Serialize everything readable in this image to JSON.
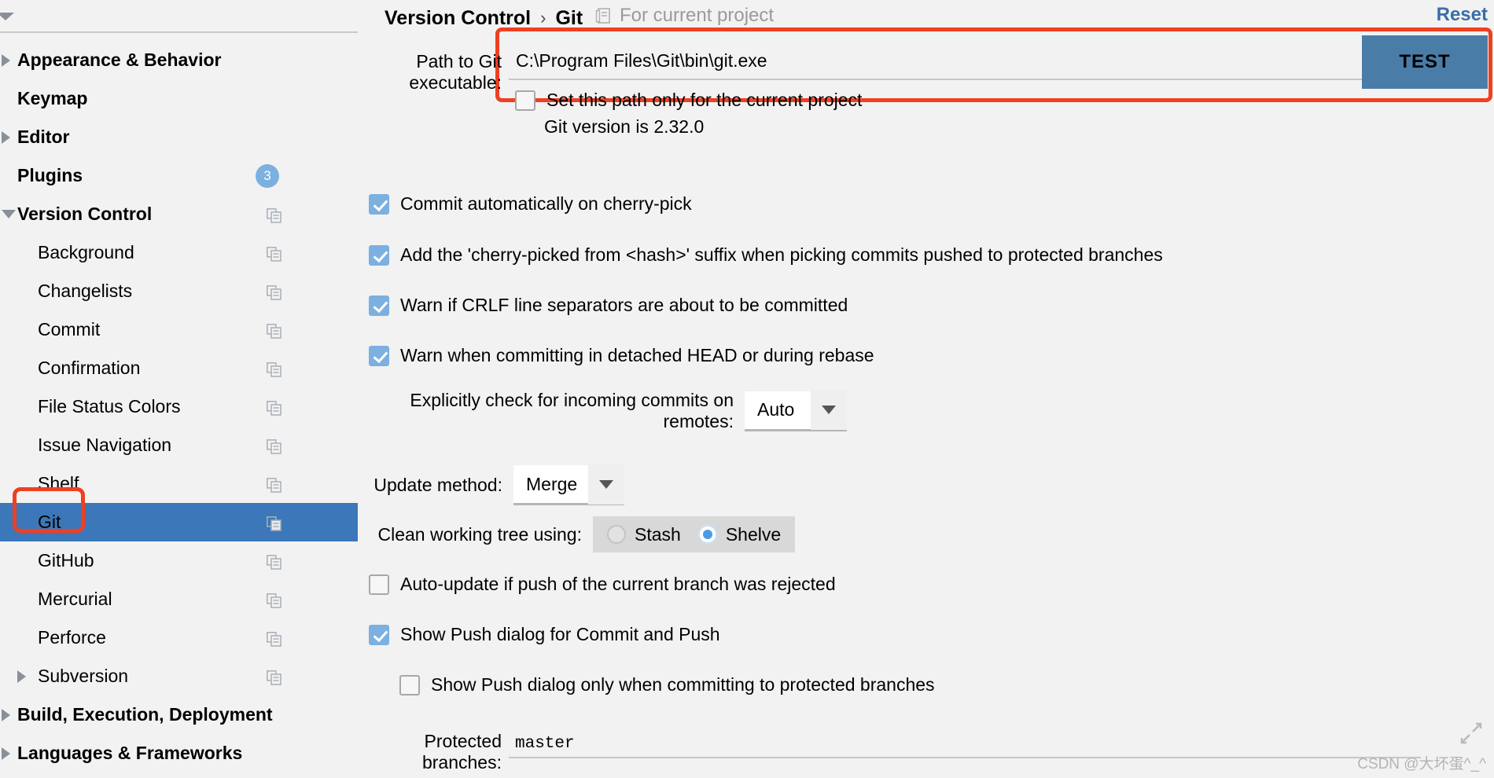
{
  "sidebar": {
    "items": [
      {
        "label": "Appearance & Behavior",
        "depth": 0,
        "twisty": "collapsed",
        "badge": null,
        "copy": false,
        "selected": false
      },
      {
        "label": "Keymap",
        "depth": 0,
        "twisty": "none",
        "badge": null,
        "copy": false,
        "selected": false
      },
      {
        "label": "Editor",
        "depth": 0,
        "twisty": "collapsed",
        "badge": null,
        "copy": false,
        "selected": false
      },
      {
        "label": "Plugins",
        "depth": 0,
        "twisty": "none",
        "badge": "3",
        "copy": false,
        "selected": false
      },
      {
        "label": "Version Control",
        "depth": 0,
        "twisty": "expanded",
        "badge": null,
        "copy": true,
        "selected": false
      },
      {
        "label": "Background",
        "depth": 1,
        "twisty": "none",
        "badge": null,
        "copy": true,
        "selected": false
      },
      {
        "label": "Changelists",
        "depth": 1,
        "twisty": "none",
        "badge": null,
        "copy": true,
        "selected": false
      },
      {
        "label": "Commit",
        "depth": 1,
        "twisty": "none",
        "badge": null,
        "copy": true,
        "selected": false
      },
      {
        "label": "Confirmation",
        "depth": 1,
        "twisty": "none",
        "badge": null,
        "copy": true,
        "selected": false
      },
      {
        "label": "File Status Colors",
        "depth": 1,
        "twisty": "none",
        "badge": null,
        "copy": true,
        "selected": false
      },
      {
        "label": "Issue Navigation",
        "depth": 1,
        "twisty": "none",
        "badge": null,
        "copy": true,
        "selected": false
      },
      {
        "label": "Shelf",
        "depth": 1,
        "twisty": "none",
        "badge": null,
        "copy": true,
        "selected": false
      },
      {
        "label": "Git",
        "depth": 1,
        "twisty": "none",
        "badge": null,
        "copy": true,
        "selected": true
      },
      {
        "label": "GitHub",
        "depth": 1,
        "twisty": "none",
        "badge": null,
        "copy": true,
        "selected": false
      },
      {
        "label": "Mercurial",
        "depth": 1,
        "twisty": "none",
        "badge": null,
        "copy": true,
        "selected": false
      },
      {
        "label": "Perforce",
        "depth": 1,
        "twisty": "none",
        "badge": null,
        "copy": true,
        "selected": false
      },
      {
        "label": "Subversion",
        "depth": 1,
        "twisty": "collapsed",
        "badge": null,
        "copy": true,
        "selected": false
      },
      {
        "label": "Build, Execution, Deployment",
        "depth": 0,
        "twisty": "collapsed",
        "badge": null,
        "copy": false,
        "selected": false
      },
      {
        "label": "Languages & Frameworks",
        "depth": 0,
        "twisty": "collapsed",
        "badge": null,
        "copy": false,
        "selected": false
      }
    ]
  },
  "header": {
    "breadcrumb_parent": "Version Control",
    "breadcrumb_separator": "›",
    "breadcrumb_current": "Git",
    "scope_label": "For current project",
    "reset_label": "Reset"
  },
  "path": {
    "label": "Path to Git executable:",
    "value": "C:\\Program Files\\Git\\bin\\git.exe",
    "placeholder": "",
    "set_path_checkbox_label": "Set this path only for the current project",
    "set_path_checked": false,
    "test_button_label": "TEST",
    "git_version_text": "Git version is 2.32.0"
  },
  "options": {
    "checkboxes": [
      {
        "label": "Commit automatically on cherry-pick",
        "checked": true
      },
      {
        "label": "Add the 'cherry-picked from <hash>' suffix when picking commits pushed to protected branches",
        "checked": true
      },
      {
        "label": "Warn if CRLF line separators are about to be committed",
        "checked": true
      },
      {
        "label": "Warn when committing in detached HEAD or during rebase",
        "checked": true
      }
    ],
    "incoming_commits": {
      "label": "Explicitly check for incoming commits on remotes:",
      "value": "Auto"
    },
    "update_method": {
      "label": "Update method:",
      "value": "Merge"
    },
    "clean_working_tree": {
      "label": "Clean working tree using:",
      "options": [
        "Stash",
        "Shelve"
      ],
      "selected": "Shelve"
    },
    "auto_update": {
      "label": "Auto-update if push of the current branch was rejected",
      "checked": false
    },
    "show_push_dialog": {
      "label": "Show Push dialog for Commit and Push",
      "checked": true
    },
    "show_push_dialog_protected": {
      "label": "Show Push dialog only when committing to protected branches",
      "checked": false
    },
    "protected_branches": {
      "label": "Protected branches:",
      "value": "master"
    }
  },
  "footer": {
    "watermark": "CSDN @大坏蛋^_^"
  },
  "colors": {
    "accent_blue": "#3b77b9",
    "highlight_red": "#ee4022",
    "checkbox_blue": "#7cb0e0",
    "test_button": "#4a7ca8",
    "link_blue": "#3a6ea8"
  }
}
